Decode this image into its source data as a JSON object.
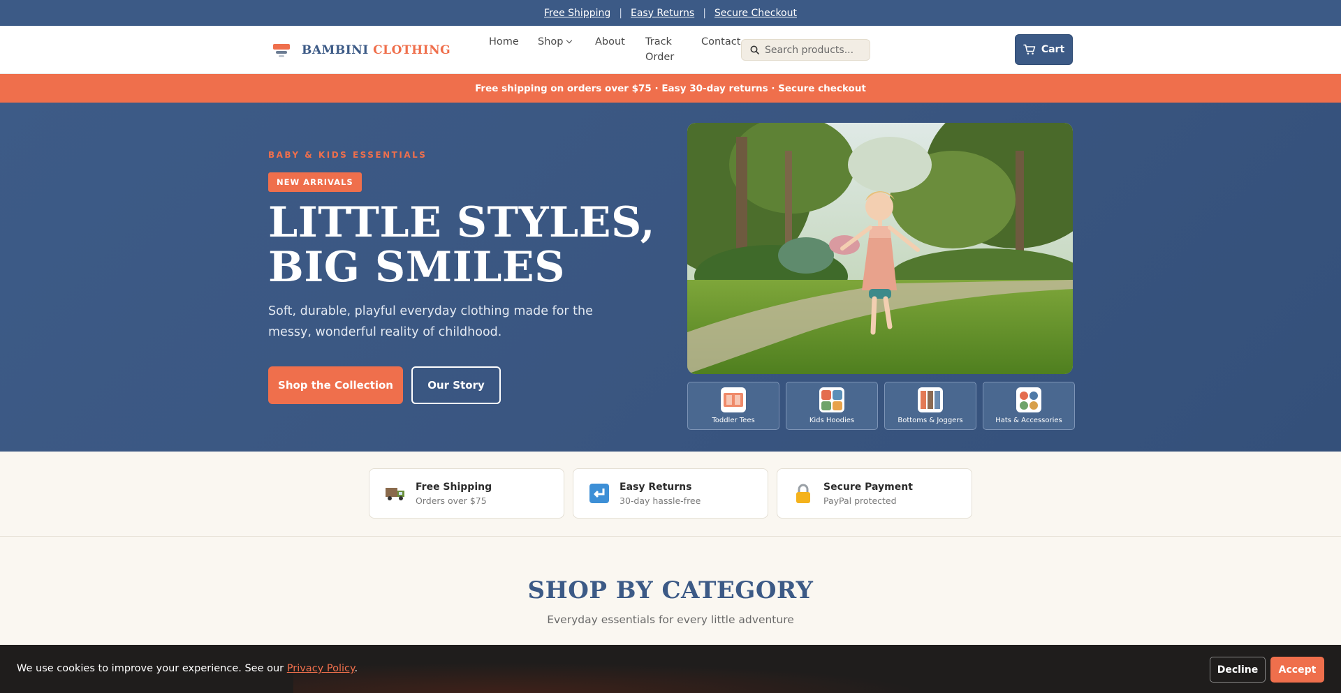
{
  "utility_bar": {
    "links": [
      "Free Shipping",
      "Easy Returns",
      "Secure Checkout"
    ],
    "separator": "|"
  },
  "header": {
    "logo_part1": "BAMBINI",
    "logo_part2": "CLOTHING",
    "nav": {
      "home": "Home",
      "shop": "Shop",
      "about": "About",
      "track_line1": "Track",
      "track_line2": "Order",
      "contact": "Contact"
    },
    "search_placeholder": "Search products...",
    "cart_label": "Cart"
  },
  "promo_bar": {
    "text": "Free shipping on orders over $75 · Easy 30-day returns · Secure checkout"
  },
  "hero": {
    "eyebrow": "BABY & KIDS ESSENTIALS",
    "badge": "NEW ARRIVALS",
    "title_line1": "LITTLE STYLES,",
    "title_line2": "BIG SMILES",
    "subtitle": "Soft, durable, playful everyday clothing made for the messy, wonderful reality of childhood.",
    "primary_cta": "Shop the Collection",
    "secondary_cta": "Our Story",
    "categories": [
      {
        "label": "Toddler Tees",
        "icon": "tee-icon"
      },
      {
        "label": "Kids Hoodies",
        "icon": "hoodie-icon"
      },
      {
        "label": "Bottoms & Joggers",
        "icon": "joggers-icon"
      },
      {
        "label": "Hats & Accessories",
        "icon": "hats-icon"
      }
    ]
  },
  "features": [
    {
      "icon": "truck-icon",
      "glyph": "🚚",
      "title": "Free Shipping",
      "desc": "Orders over $75"
    },
    {
      "icon": "return-icon",
      "glyph": "↩",
      "title": "Easy Returns",
      "desc": "30-day hassle-free"
    },
    {
      "icon": "lock-icon",
      "glyph": "🔒",
      "title": "Secure Payment",
      "desc": "PayPal protected"
    }
  ],
  "section": {
    "title": "SHOP BY CATEGORY",
    "subtitle": "Everyday essentials for every little adventure"
  },
  "cookie": {
    "text": "We use cookies to improve your experience. See our",
    "link": "Privacy Policy",
    "period": ".",
    "decline": "Decline",
    "accept": "Accept"
  },
  "colors": {
    "brand_blue": "#3c5a86",
    "brand_coral": "#ef6f4c",
    "cream": "#faf7f1"
  }
}
